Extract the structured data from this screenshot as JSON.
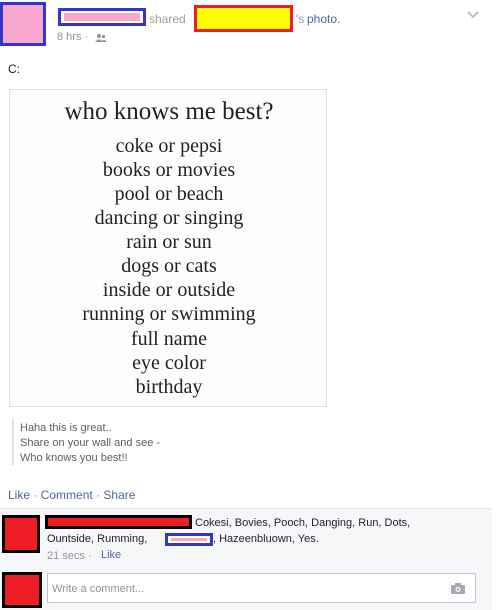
{
  "post": {
    "shared_text": "shared",
    "photo_suffix": "'s",
    "photo_link": "photo.",
    "time": "8 hrs ·",
    "caption": "C:",
    "image": {
      "title": "who knows me best?",
      "lines": [
        "coke or pepsi",
        "books or movies",
        "pool or beach",
        "dancing or singing",
        "rain or sun",
        "dogs or cats",
        "inside or outside",
        "running or swimming",
        "full name",
        "eye color",
        "birthday"
      ]
    },
    "quote": [
      "Haha this is great..",
      "Share on your wall and see -",
      "Who knows you best!!"
    ],
    "actions": {
      "like": "Like",
      "comment": "Comment",
      "share": "Share",
      "sep": "·"
    }
  },
  "comment": {
    "text_part1": "Cokesi, Bovies, Pooch, Danging, Run, Dots,",
    "text_part2a": "Ountside, Rumming,",
    "text_part2b": ", Hazeenbluown, Yes.",
    "time": "21 secs ·",
    "like": "Like"
  },
  "composer": {
    "placeholder": "Write a comment..."
  },
  "colors": {
    "pink": "#f7a8cc",
    "blue": "#3535c8",
    "red": "#ee1c24",
    "yellow": "#fffe00",
    "link": "#4b67a1"
  }
}
